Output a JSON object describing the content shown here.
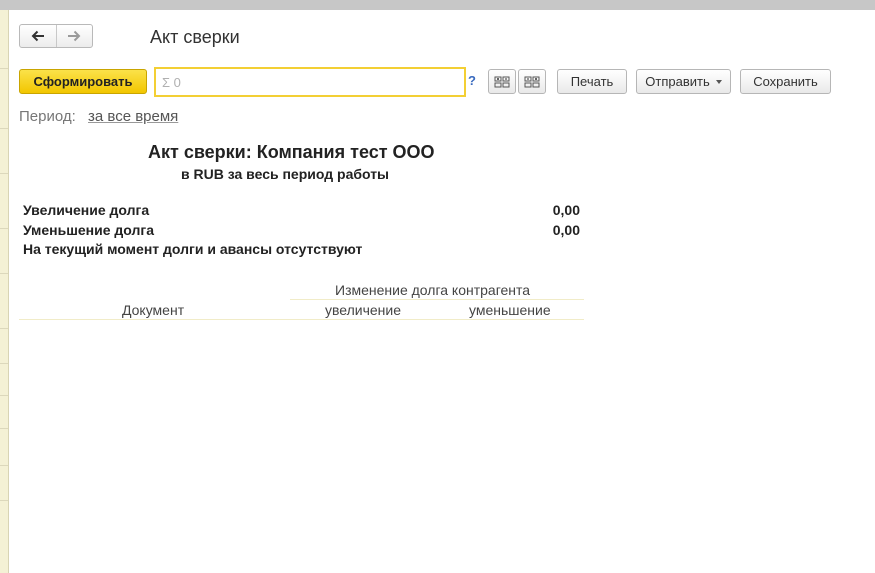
{
  "window": {
    "title": "Акт сверки"
  },
  "navigation": {
    "back_icon": "arrow-left-icon",
    "forward_icon": "arrow-right-icon"
  },
  "toolbar": {
    "generate_label": "Сформировать",
    "search_value": "Σ 0",
    "help_label": "?",
    "expand_icon": "expand-groups-icon",
    "collapse_icon": "collapse-groups-icon",
    "print_label": "Печать",
    "send_label": "Отправить",
    "save_label": "Сохранить"
  },
  "period": {
    "label": "Период:",
    "value": "за все время"
  },
  "report": {
    "title": "Акт сверки: Компания тест ООО",
    "subtitle": "в RUB за весь период работы",
    "summary": [
      {
        "label": "Увеличение долга",
        "value": "0,00"
      },
      {
        "label": "Уменьшение долга",
        "value": "0,00"
      }
    ],
    "note": "На текущий момент долги и авансы отсутствуют",
    "table": {
      "group_header": "Изменение долга контрагента",
      "document_header": "Документ",
      "increase_header": "увеличение",
      "decrease_header": "уменьшение"
    }
  },
  "colors": {
    "accent": "#f2c600",
    "accent_border": "#f3cf34",
    "background": "#ffffff"
  }
}
